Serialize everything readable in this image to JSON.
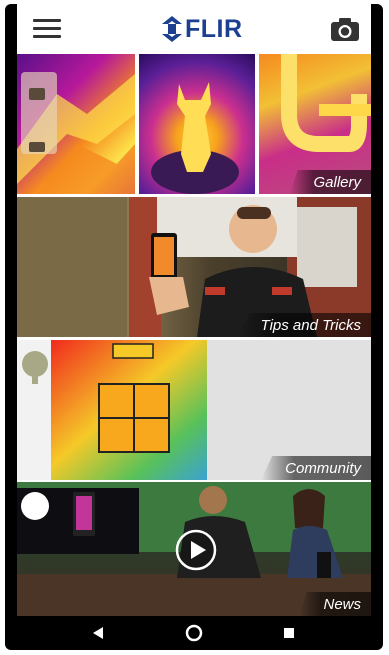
{
  "app": {
    "logo_text": "FLIR",
    "brand_color": "#1d3f8f"
  },
  "toolbar": {
    "menu_icon": "hamburger-menu-icon",
    "camera_icon": "camera-icon"
  },
  "tiles": {
    "gallery": {
      "label": "Gallery"
    },
    "tips": {
      "label": "Tips and Tricks"
    },
    "community": {
      "label": "Community"
    },
    "news": {
      "label": "News"
    }
  },
  "navbar": {
    "back_icon": "back-triangle-icon",
    "home_icon": "home-circle-icon",
    "recents_icon": "recents-square-icon"
  }
}
